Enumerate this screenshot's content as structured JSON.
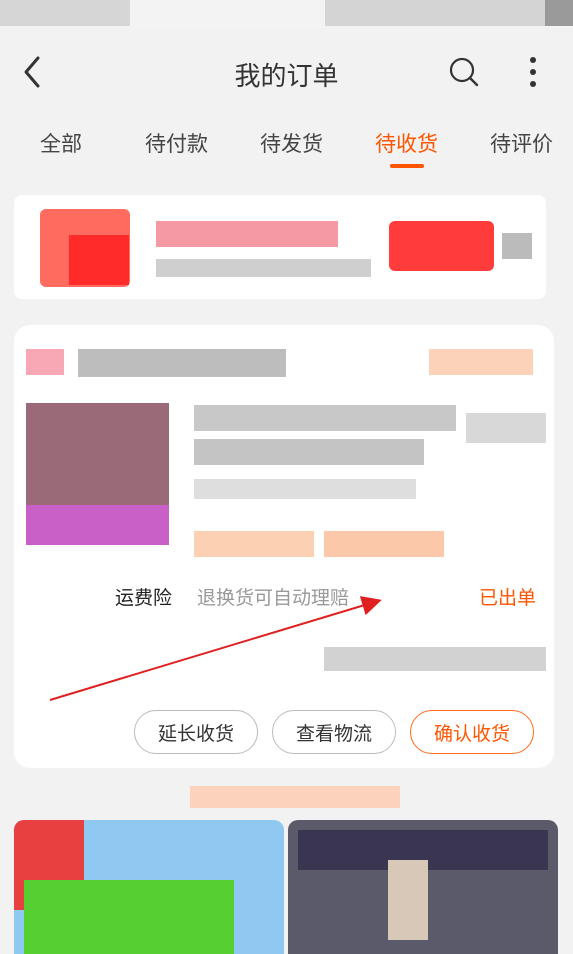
{
  "header": {
    "title": "我的订单"
  },
  "tabs": [
    {
      "label": "全部",
      "active": false
    },
    {
      "label": "待付款",
      "active": false
    },
    {
      "label": "待发货",
      "active": false
    },
    {
      "label": "待收货",
      "active": true
    },
    {
      "label": "待评价",
      "active": false
    }
  ],
  "order": {
    "insurance_label": "运费险",
    "insurance_desc": "退换货可自动理赔",
    "insurance_status": "已出单",
    "buttons": {
      "extend": "延长收货",
      "logistics": "查看物流",
      "confirm": "确认收货"
    }
  },
  "colors": {
    "accent": "#ff5500",
    "annotation_arrow": "#e02020"
  },
  "icons": [
    "back-arrow-icon",
    "search-icon",
    "more-vertical-icon"
  ]
}
